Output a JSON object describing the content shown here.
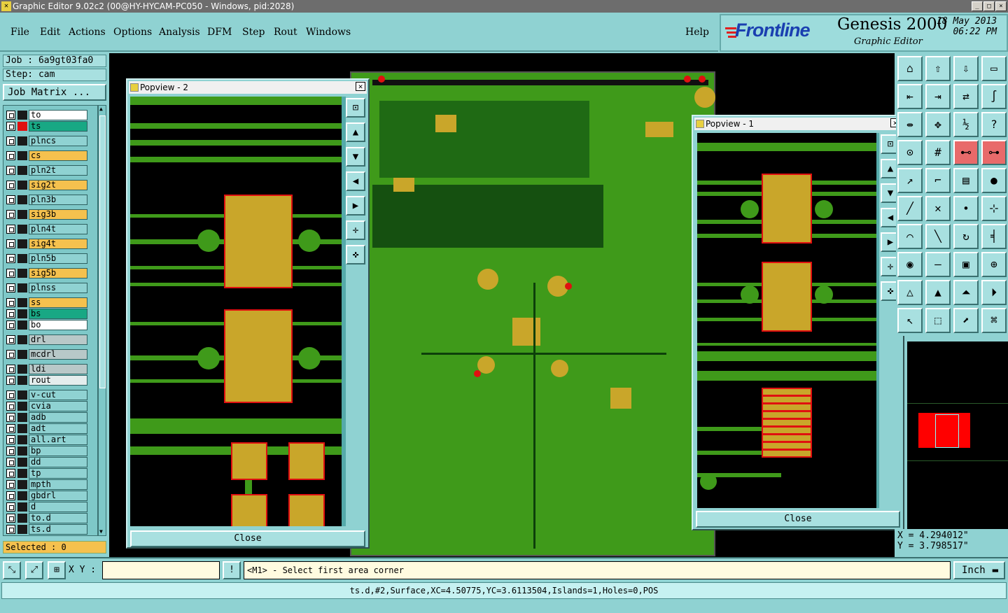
{
  "titlebar": {
    "title": "Graphic Editor 9.02c2 (00@HY-HYCAM-PC050 - Windows, pid:2028)",
    "minimize": "_",
    "maximize": "□",
    "close": "×"
  },
  "menu": {
    "file": "File",
    "edit": "Edit",
    "actions": "Actions",
    "options": "Options",
    "analysis": "Analysis",
    "dfm": "DFM",
    "step": "Step",
    "rout": "Rout",
    "windows": "Windows",
    "help": "Help"
  },
  "brand": {
    "logo": "Frontline",
    "product": "Genesis 2000",
    "subtitle": "Graphic Editor",
    "date": "18 May 2013",
    "time": "06:22 PM"
  },
  "job": {
    "job_label": "Job : 6a9gt03fa0",
    "step_label": "Step: cam",
    "matrix_button": "Job Matrix ..."
  },
  "layers": [
    {
      "name": "to",
      "color": "#ffffff"
    },
    {
      "name": "ts",
      "color": "#18a884"
    },
    {
      "name": "plncs",
      "color": "#8fd2d2"
    },
    {
      "name": "cs",
      "color": "#f5c14e"
    },
    {
      "name": "pln2t",
      "color": "#8fd2d2"
    },
    {
      "name": "sig2t",
      "color": "#f5c14e"
    },
    {
      "name": "pln3b",
      "color": "#8fd2d2"
    },
    {
      "name": "sig3b",
      "color": "#f5c14e"
    },
    {
      "name": "pln4t",
      "color": "#8fd2d2"
    },
    {
      "name": "sig4t",
      "color": "#f5c14e"
    },
    {
      "name": "pln5b",
      "color": "#8fd2d2"
    },
    {
      "name": "sig5b",
      "color": "#f5c14e"
    },
    {
      "name": "plnss",
      "color": "#8fd2d2"
    },
    {
      "name": "ss",
      "color": "#f5c14e"
    },
    {
      "name": "bs",
      "color": "#18a884"
    },
    {
      "name": "bo",
      "color": "#ffffff"
    },
    {
      "name": "drl",
      "color": "#b8c8c8"
    },
    {
      "name": "mcdrl",
      "color": "#b8c8c8"
    },
    {
      "name": "ldi",
      "color": "#b8c8c8"
    },
    {
      "name": "rout",
      "color": "#e4eded"
    },
    {
      "name": "v-cut",
      "color": "#8fd2d2"
    },
    {
      "name": "cvia",
      "color": "#8fd2d2"
    },
    {
      "name": "adb",
      "color": "#8fd2d2"
    },
    {
      "name": "adt",
      "color": "#8fd2d2"
    },
    {
      "name": "all.art",
      "color": "#8fd2d2"
    },
    {
      "name": "bp",
      "color": "#8fd2d2"
    },
    {
      "name": "dd",
      "color": "#8fd2d2"
    },
    {
      "name": "tp",
      "color": "#8fd2d2"
    },
    {
      "name": "mpth",
      "color": "#8fd2d2"
    },
    {
      "name": "gbdrl",
      "color": "#8fd2d2"
    },
    {
      "name": "d",
      "color": "#8fd2d2"
    },
    {
      "name": "to.d",
      "color": "#8fd2d2"
    },
    {
      "name": "ts.d",
      "color": "#8fd2d2"
    }
  ],
  "selected": "Selected : 0",
  "popview2": {
    "title": "Popview - 2",
    "close_label": "Close"
  },
  "popview1": {
    "title": "Popview - 1",
    "close_label": "Close"
  },
  "coords": {
    "x": "X = 4.294012\"",
    "y": "Y = 3.798517\""
  },
  "bottom": {
    "xy_label": "X Y :",
    "xy_value": "",
    "prompt": "<M1> - Select first area corner",
    "unit": "Inch",
    "info": "!"
  },
  "status": "ts.d,#2,Surface,XC=4.50775,YC=3.6113504,Islands=1,Holes=0,POS",
  "icons": [
    "pan-icon",
    "zoom-icon",
    "grid-icon"
  ]
}
